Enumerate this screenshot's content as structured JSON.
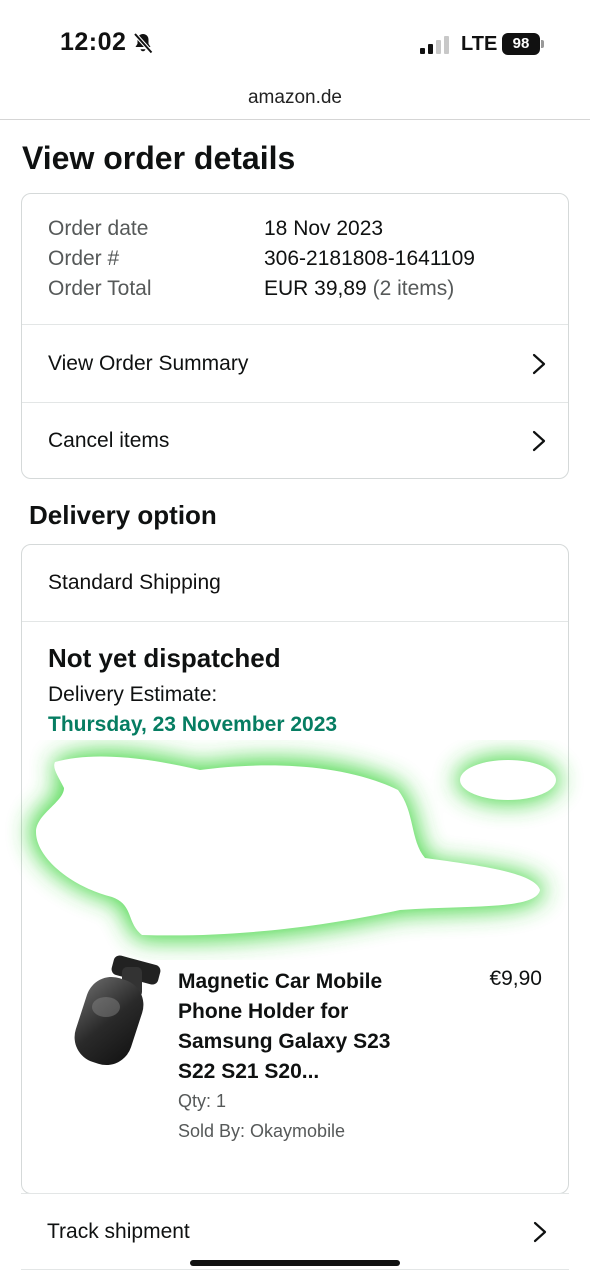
{
  "status_bar": {
    "time": "12:02",
    "network": "LTE",
    "battery": "98"
  },
  "browser": {
    "url": "amazon.de"
  },
  "page": {
    "title": "View order details"
  },
  "order": {
    "date_label": "Order date",
    "date_value": "18 Nov 2023",
    "number_label": "Order #",
    "number_value": "306-2181808-1641109",
    "total_label": "Order Total",
    "total_value": "EUR 39,89",
    "total_items": "(2 items)",
    "summary_link": "View Order Summary",
    "cancel_link": "Cancel items"
  },
  "delivery": {
    "section_title": "Delivery option",
    "method": "Standard Shipping",
    "status": "Not yet dispatched",
    "estimate_label": "Delivery Estimate:",
    "estimate_date": "Thursday, 23 November 2023",
    "estimate_color": "#067d62"
  },
  "product": {
    "title": "Magnetic Car Mobile Phone Holder for Samsung Galaxy S23 S22 S21 S20...",
    "price": "€9,90",
    "qty": "Qty: 1",
    "seller": "Sold By: Okaymobile"
  },
  "actions": {
    "track": "Track shipment"
  },
  "icons": {
    "bell": "bell-slash-icon",
    "signal": "signal-bars-icon",
    "chevron": "chevron-right-icon"
  }
}
